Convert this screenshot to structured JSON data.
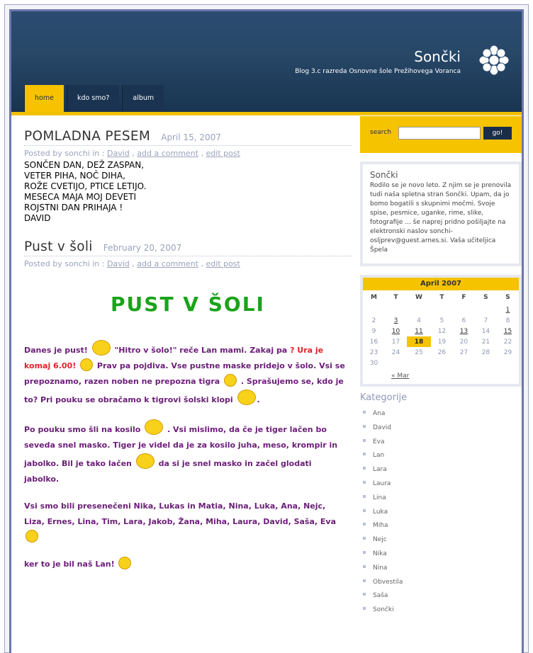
{
  "header": {
    "title": "Sončki",
    "subtitle": "Blog 3.c razreda Osnovne šole Prežihovega Voranca"
  },
  "nav": [
    {
      "label": "home"
    },
    {
      "label": "kdo smo?"
    },
    {
      "label": "album"
    }
  ],
  "posts": [
    {
      "title": "POMLADNA PESEM",
      "date": "April 15, 2007",
      "meta_prefix": "Posted by sonchi in :",
      "author": "David",
      "comment": "add a comment",
      "edit": "edit post",
      "lines": [
        "SONČEN DAN, DEŽ ZASPAN,",
        "VETER PIHA, NOČ DIHA,",
        "ROŽE CVETIJO, PTICE LETIJO.",
        "MESECA MAJA MOJ DEVETI",
        "ROJSTNI DAN PRIHAJA !",
        "DAVID"
      ]
    },
    {
      "title": "Pust v šoli",
      "date": "February 20, 2007",
      "meta_prefix": "Posted by sonchi in :",
      "author": "David",
      "comment": "add a comment",
      "edit": "edit post",
      "banner": "PUST V ŠOLI",
      "p1": "Danes je pust!",
      "p1b": "\"Hitro v šolo!\" reče Lan mami. Zakaj pa",
      "p1c": "? Ura je komaj 6.00!",
      "p1d": "Prav pa pojdiva. Vse pustne maske pridejo v šolo. Vsi se prepoznamo, razen noben ne prepozna tigra",
      "p1e": ". Sprašujemo se, kdo je to? Pri pouku se obračamo k tigrovi šolski klopi",
      "p2a": "Po pouku smo šli na kosilo",
      "p2b": ". Vsi mislimo, da če je tiger lačen bo seveda snel masko. Tiger je videl da je za kosilo juha, meso, krompir in jabolko. Bil je tako lačen",
      "p2c": "da si je snel masko in začel glodati jabolko.",
      "p3": "Vsi smo bili presenečeni Nika, Lukas in Matia, Nina, Luka, Ana, Nejc, Liza, Ernes, Lina, Tim, Lara, Jakob, Žana, Miha, Laura, David, Saša, Eva",
      "p4": "ker to je bil naš Lan!"
    }
  ],
  "sidebar": {
    "search_label": "search",
    "search_button": "go!",
    "about_title": "Sončki",
    "about_text": "Rodilo se je novo leto. Z njim se je prenovila tudi naša spletna stran Sončki. Upam, da jo bomo bogatili s skupnimi močmi. Svoje spise, pesmice, uganke, rime, slike, fotografije ... še naprej pridno pošiljajte na elektronski naslov sonchi-osljprev@guest.arnes.si. Vaša učiteljica Špela",
    "calendar": {
      "month": "April 2007",
      "days": [
        "M",
        "T",
        "W",
        "T",
        "F",
        "S",
        "S"
      ],
      "rows": [
        [
          "",
          "",
          "",
          "",
          "",
          "",
          "1"
        ],
        [
          "2",
          "3",
          "4",
          "5",
          "6",
          "7",
          "8"
        ],
        [
          "9",
          "10",
          "11",
          "12",
          "13",
          "14",
          "15"
        ],
        [
          "16",
          "17",
          "18",
          "19",
          "20",
          "21",
          "22"
        ],
        [
          "23",
          "24",
          "25",
          "26",
          "27",
          "28",
          "29"
        ],
        [
          "30",
          "",
          "",
          "",
          "",
          "",
          ""
        ]
      ],
      "linked": [
        "1",
        "3",
        "10",
        "11",
        "13",
        "15"
      ],
      "today": "18",
      "prev": "« Mar"
    },
    "categories_title": "Kategorije",
    "categories": [
      "Ana",
      "David",
      "Eva",
      "Lan",
      "Lara",
      "Laura",
      "Lina",
      "Luka",
      "Miha",
      "Nejc",
      "Nika",
      "Nina",
      "Obvestila",
      "Saša",
      "Sončki"
    ]
  }
}
